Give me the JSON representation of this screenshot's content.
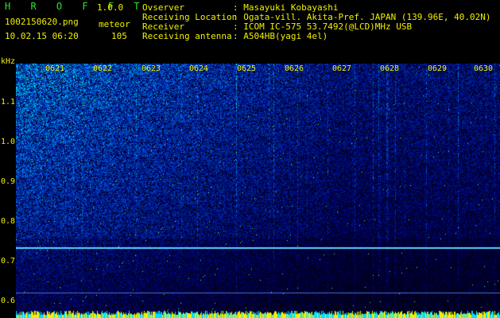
{
  "header": {
    "app_name": "H R O F F T",
    "version": "1.0.0",
    "filename": "1002150620.png",
    "event_type": "meteor",
    "datetime": "10.02.15 06:20",
    "count": "105",
    "fields": [
      {
        "label": "Ovserver",
        "value": ": Masayuki Kobayashi"
      },
      {
        "label": "Receiving Location",
        "value": ": Ogata-vill. Akita-Pref. JAPAN (139.96E, 40.02N)"
      },
      {
        "label": "Receiver",
        "value": ": ICOM IC-575 53.7492(@LCD)MHz USB"
      },
      {
        "label": "Receiving antenna",
        "value": ": A504HB(yagi 4el)"
      }
    ]
  },
  "axis": {
    "unit": "kHz",
    "y_ticks": [
      "1.1",
      "1.0",
      "0.9",
      "0.8",
      "0.7",
      "0.6"
    ],
    "time_ticks": [
      "0621",
      "0622",
      "0623",
      "0624",
      "0625",
      "0626",
      "0627",
      "0628",
      "0629",
      "0630"
    ]
  },
  "colors": {
    "background": "#000000",
    "header_green": "#26e626",
    "header_yellow": "#f0f000",
    "spectrum_low": "#0a1e8c",
    "spectrum_high": "#3cff5a",
    "baseline_cyan": "#00e0ff",
    "baseline_yellow": "#f0f000",
    "line_color": "#5ad2ff"
  }
}
